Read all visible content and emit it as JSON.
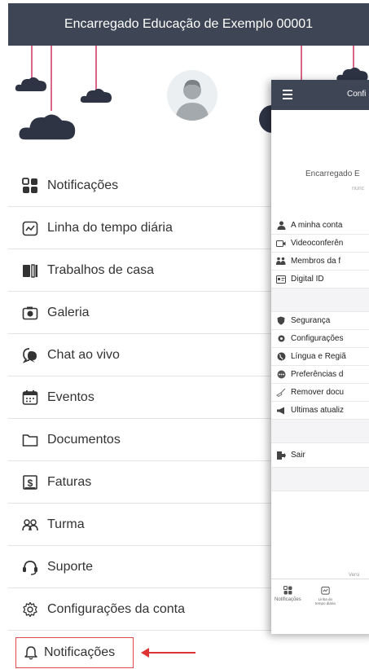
{
  "header": {
    "title": "Encarregado Educação de Exemplo 00001"
  },
  "menu": {
    "items": [
      {
        "label": "Notificações",
        "icon": "notifications-grid-icon"
      },
      {
        "label": "Linha do tempo diária",
        "icon": "timeline-icon"
      },
      {
        "label": "Trabalhos de casa",
        "icon": "homework-icon"
      },
      {
        "label": "Galeria",
        "icon": "camera-icon"
      },
      {
        "label": "Chat ao vivo",
        "icon": "chat-icon"
      },
      {
        "label": "Eventos",
        "icon": "calendar-icon"
      },
      {
        "label": "Documentos",
        "icon": "folder-icon"
      },
      {
        "label": "Faturas",
        "icon": "invoice-icon"
      },
      {
        "label": "Turma",
        "icon": "group-icon"
      },
      {
        "label": "Suporte",
        "icon": "headset-icon"
      },
      {
        "label": "Configurações da conta",
        "icon": "gear-icon"
      }
    ],
    "highlighted": {
      "label": "Notificações",
      "icon": "bell-icon"
    }
  },
  "overlay": {
    "header_title": "Confi",
    "name": "Encarregado E",
    "sub": "nunc",
    "group1": [
      {
        "label": "A minha conta",
        "icon": "user-icon"
      },
      {
        "label": "Videoconferên",
        "icon": "video-icon"
      },
      {
        "label": "Membros da f",
        "icon": "family-icon"
      },
      {
        "label": "Digital ID",
        "icon": "id-card-icon"
      }
    ],
    "group2": [
      {
        "label": "Segurança",
        "icon": "shield-icon"
      },
      {
        "label": "Configurações",
        "icon": "gear-icon"
      },
      {
        "label": "Língua e Regiã",
        "icon": "globe-icon"
      },
      {
        "label": "Preferências d",
        "icon": "dots-icon"
      },
      {
        "label": "Remover docu",
        "icon": "broom-icon"
      },
      {
        "label": "Ultimas atualiz",
        "icon": "megaphone-icon"
      }
    ],
    "logout": {
      "label": "Sair",
      "icon": "logout-icon"
    },
    "version": "Versi",
    "tabs": [
      {
        "label": "Notificações"
      },
      {
        "label_line1": "Linha do",
        "label_line2": "tempo diária"
      }
    ]
  },
  "colors": {
    "header_bg": "#3e4554",
    "string": "#d8678a",
    "cloud": "#2e3444",
    "highlight_border": "#e04a4a"
  }
}
